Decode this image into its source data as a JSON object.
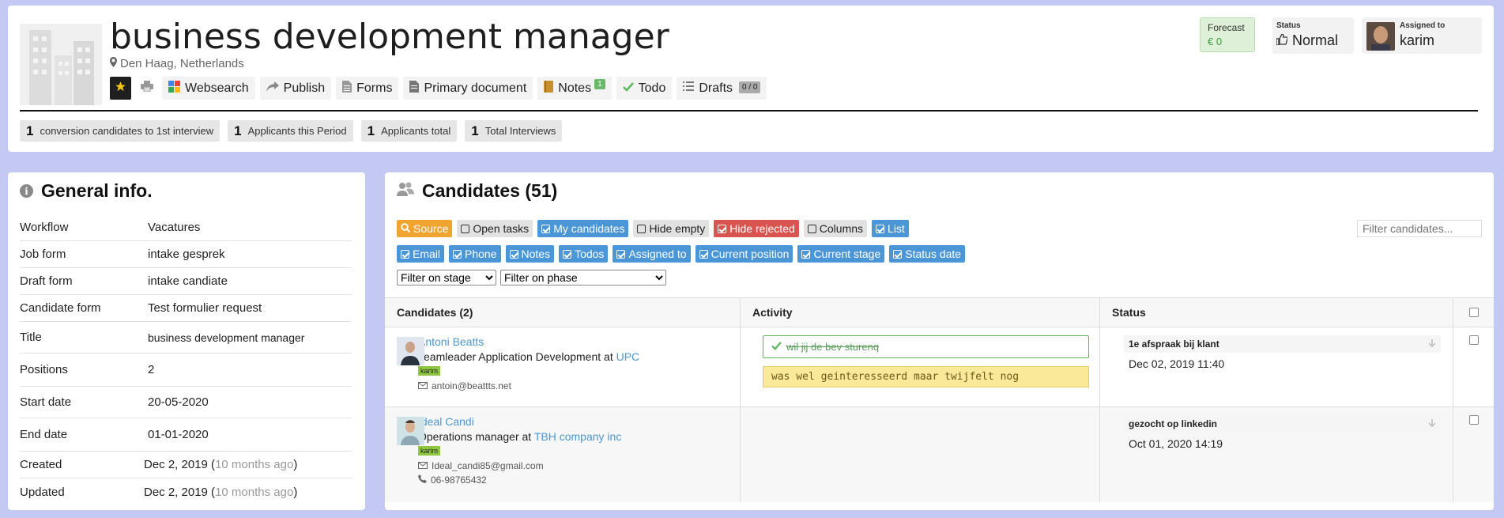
{
  "header": {
    "title": "business development manager",
    "location": "Den Haag, Netherlands",
    "toolbar": {
      "websearch": "Websearch",
      "publish": "Publish",
      "forms": "Forms",
      "primary_document": "Primary document",
      "notes": "Notes",
      "notes_count": "1",
      "todo": "Todo",
      "drafts": "Drafts",
      "drafts_count": "0 / 0"
    },
    "stats": [
      {
        "value": "1",
        "label": "conversion candidates to 1st interview"
      },
      {
        "value": "1",
        "label": "Applicants this Period"
      },
      {
        "value": "1",
        "label": "Applicants total"
      },
      {
        "value": "1",
        "label": "Total Interviews"
      }
    ],
    "forecast": {
      "label": "Forecast",
      "value": "€ 0"
    },
    "status": {
      "label": "Status",
      "value": "Normal"
    },
    "assigned": {
      "label": "Assigned to",
      "value": "karim"
    }
  },
  "general": {
    "title": "General info.",
    "rows": [
      {
        "key": "Workflow",
        "value": "Vacatures"
      },
      {
        "key": "Job form",
        "value": "intake gesprek"
      },
      {
        "key": "Draft form",
        "value": "intake candiate"
      },
      {
        "key": "Candidate form",
        "value": "Test formulier request"
      },
      {
        "key": "Title",
        "value": "business development manager"
      },
      {
        "key": "Positions",
        "value": "2"
      },
      {
        "key": "Start date",
        "value": "20-05-2020"
      },
      {
        "key": "End date",
        "value": "01-01-2020"
      },
      {
        "key": "Created",
        "value": "Dec 2, 2019 (",
        "muted": "10 months ago",
        "tail": ")"
      },
      {
        "key": "Updated",
        "value": "Dec 2, 2019 (",
        "muted": "10 months ago",
        "tail": ")"
      }
    ]
  },
  "candidates": {
    "title": "Candidates (51)",
    "filters_row1": [
      "Source",
      "Open tasks",
      "My candidates",
      "Hide empty",
      "Hide rejected",
      "Columns",
      "List"
    ],
    "filters_row2": [
      "Email",
      "Phone",
      "Notes",
      "Todos",
      "Assigned to",
      "Current position",
      "Current stage",
      "Status date"
    ],
    "filter_placeholder": "Filter candidates...",
    "select_stage": "Filter on stage",
    "select_phase": "Filter on phase",
    "columns": {
      "candidates": "Candidates (2)",
      "activity": "Activity",
      "status": "Status"
    },
    "rows": [
      {
        "name": "Antoni Beatts",
        "job": "Teamleader Application Development at ",
        "company": "UPC",
        "owner": "karim",
        "email": "antoin@beattts.net",
        "phone": "",
        "todo_done": "wil jij de bev sturenq",
        "note": "was wel geinteresseerd maar twijfelt nog",
        "stage": "1e afspraak bij klant",
        "date": "Dec 02, 2019 11:40"
      },
      {
        "name": "Ideal Candi",
        "job": "Operations manager at ",
        "company": "TBH company inc",
        "owner": "karim",
        "email": "Ideal_candi85@gmail.com",
        "phone": "06-98765432",
        "todo_done": "",
        "note": "",
        "stage": "gezocht op linkedin",
        "date": "Oct 01, 2020 14:19"
      }
    ]
  }
}
